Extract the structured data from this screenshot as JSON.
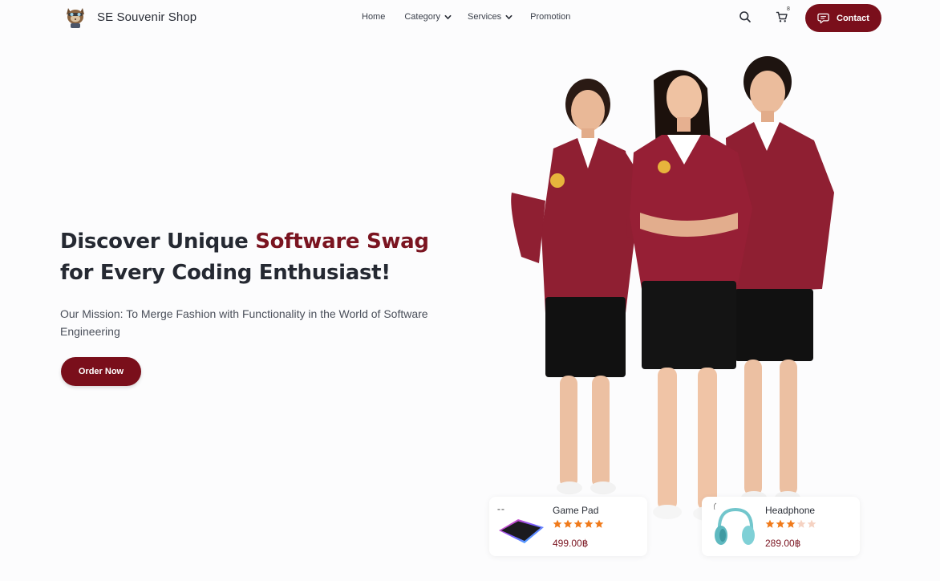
{
  "brand": {
    "name": "SE Souvenir Shop",
    "logo": "cat-mascot-logo"
  },
  "nav": {
    "home": "Home",
    "category": "Category",
    "services": "Services",
    "promotion": "Promotion"
  },
  "header_actions": {
    "search_icon": "search-icon",
    "cart_icon": "cart-icon",
    "cart_count": "8",
    "contact_label": "Contact"
  },
  "hero": {
    "headline_part1": "Discover Unique ",
    "headline_accent": "Software Swag",
    "headline_part2": " for Every Coding Enthusiast!",
    "mission": "Our Mission: To Merge Fashion with Functionality in the World of Software Engineering",
    "cta": "Order Now"
  },
  "products": [
    {
      "name": "Game Pad",
      "rating": 5,
      "max_rating": 5,
      "price": "499.00฿"
    },
    {
      "name": "Headphone",
      "rating": 3,
      "max_rating": 5,
      "price": "289.00฿"
    }
  ],
  "colors": {
    "brand_primary": "#7a0f1b",
    "accent_text": "#7a1420",
    "star_filled": "#f07a1a",
    "star_empty": "#f5d2c2",
    "background": "#fcfcfd"
  }
}
